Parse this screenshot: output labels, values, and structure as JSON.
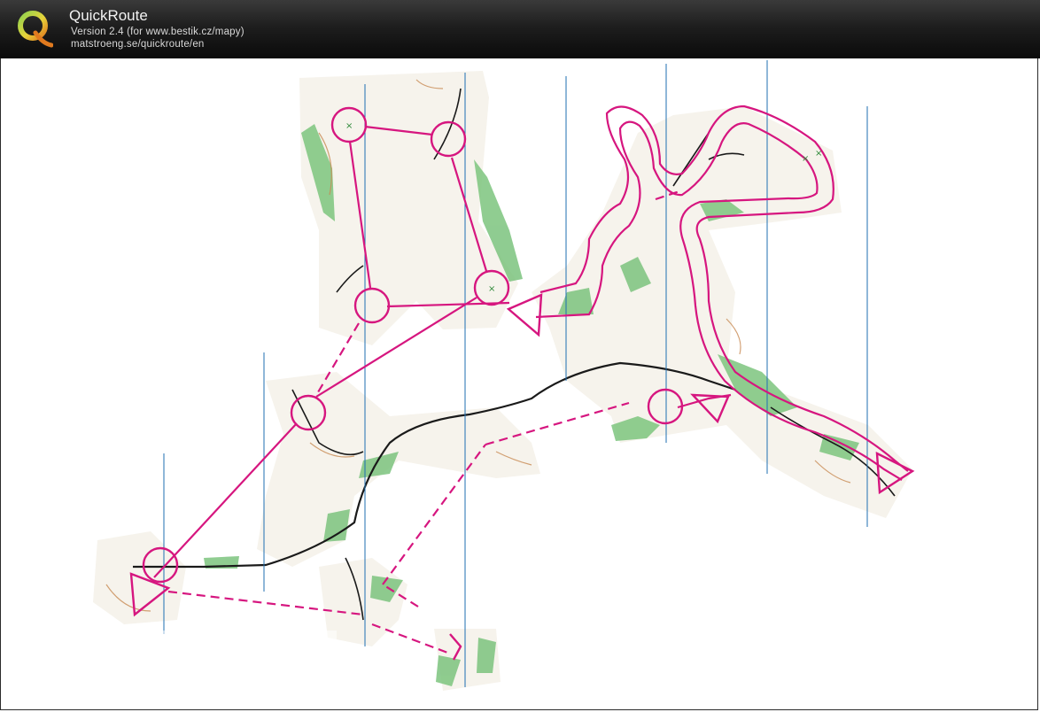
{
  "header": {
    "app_name": "QuickRoute",
    "version_line": "Version 2.4  (for www.bestik.cz/mapy)",
    "url_line": "matstroeng.se/quickroute/en"
  },
  "colors": {
    "header_bg": "#111111",
    "course_magenta": "#d6167f",
    "meridian_blue": "#1f6fb2",
    "vegetation_green": "#6fbf73",
    "trail_black": "#1a1a1a"
  },
  "icons": {
    "logo": "quickroute-q-logo"
  }
}
